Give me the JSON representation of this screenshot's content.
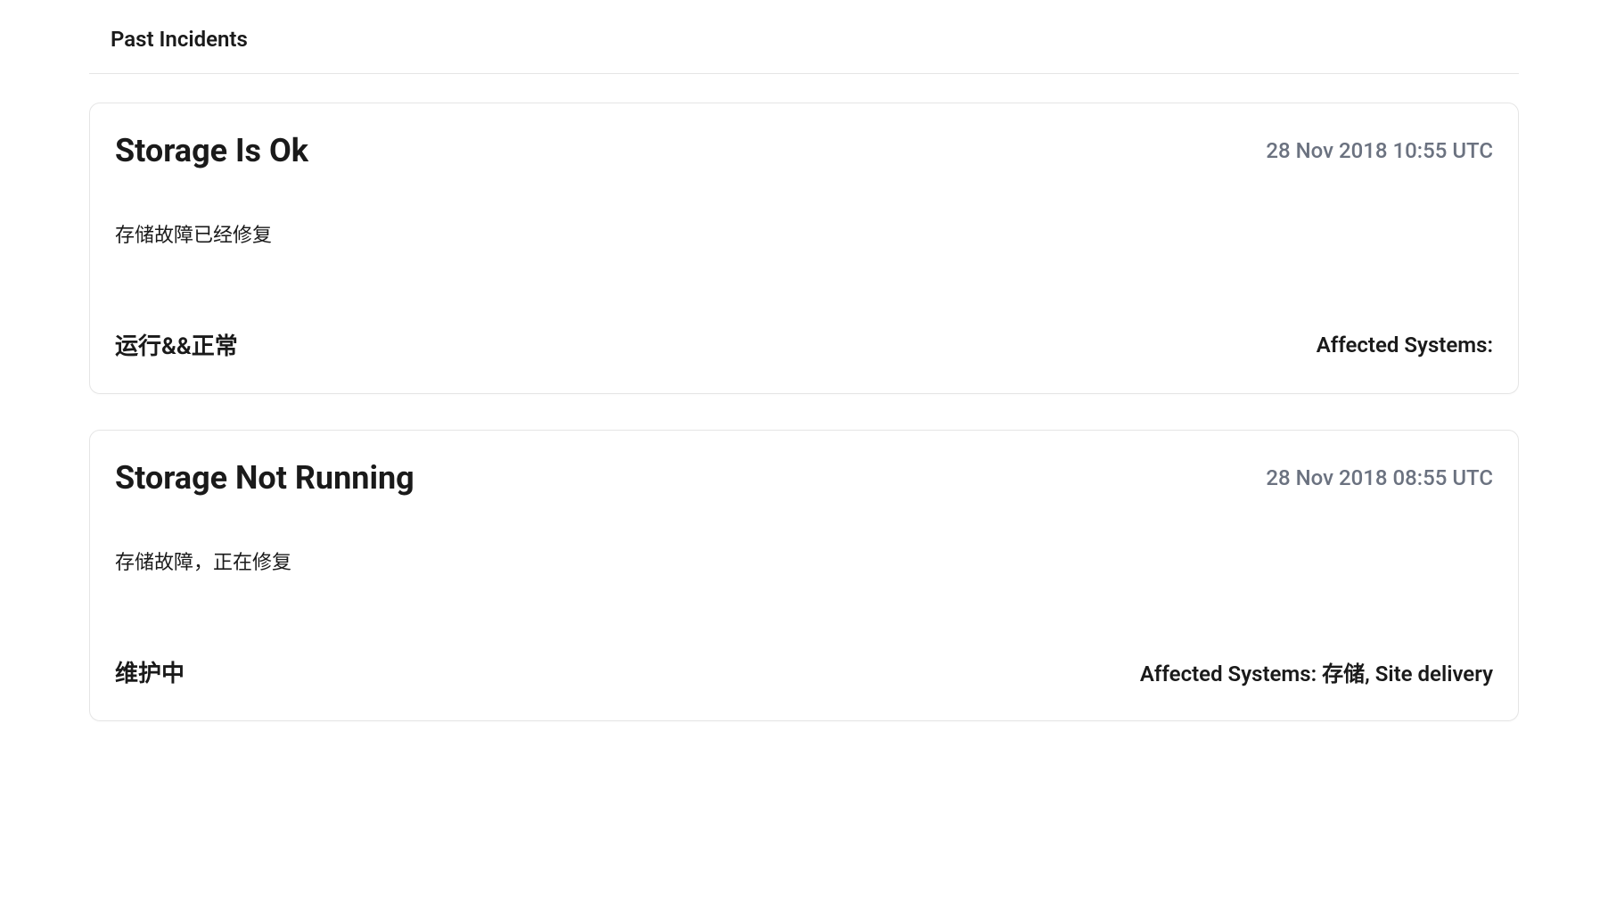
{
  "section_heading": "Past Incidents",
  "incidents": [
    {
      "title": "Storage Is Ok",
      "timestamp": "28 Nov 2018 10:55 UTC",
      "description": "存储故障已经修复",
      "status": "运行&&正常",
      "affected_label": "Affected Systems:",
      "affected_value": ""
    },
    {
      "title": "Storage Not Running",
      "timestamp": "28 Nov 2018 08:55 UTC",
      "description": "存储故障，正在修复",
      "status": "维护中",
      "affected_label": "Affected Systems:",
      "affected_value": " 存储, Site delivery"
    }
  ]
}
